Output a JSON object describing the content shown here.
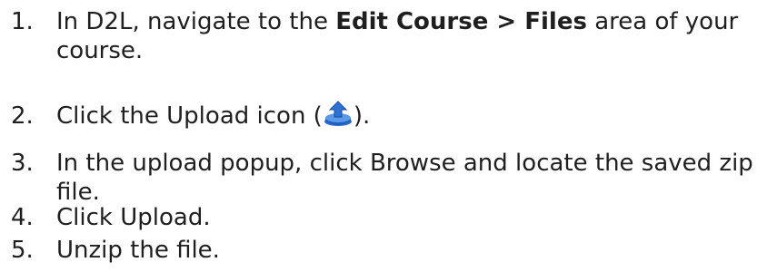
{
  "steps": [
    {
      "number": "1.",
      "prefix": "In D2L, navigate to the ",
      "bold": "Edit Course > Files",
      "suffix": " area of your",
      "line2": "course."
    },
    {
      "number": "2.",
      "prefix": "Click the Upload icon (",
      "icon": "upload-icon",
      "suffix": ")."
    },
    {
      "number": "3.",
      "line1": "In the upload popup, click Browse and locate the saved zip",
      "line2": "file."
    },
    {
      "number": "4.",
      "text": "Click Upload."
    },
    {
      "number": "5.",
      "text": "Unzip the file."
    }
  ],
  "colors": {
    "text": "#1f1f1f",
    "icon_tray": "#3f7fd6",
    "icon_arrow": "#3f7fd6"
  }
}
